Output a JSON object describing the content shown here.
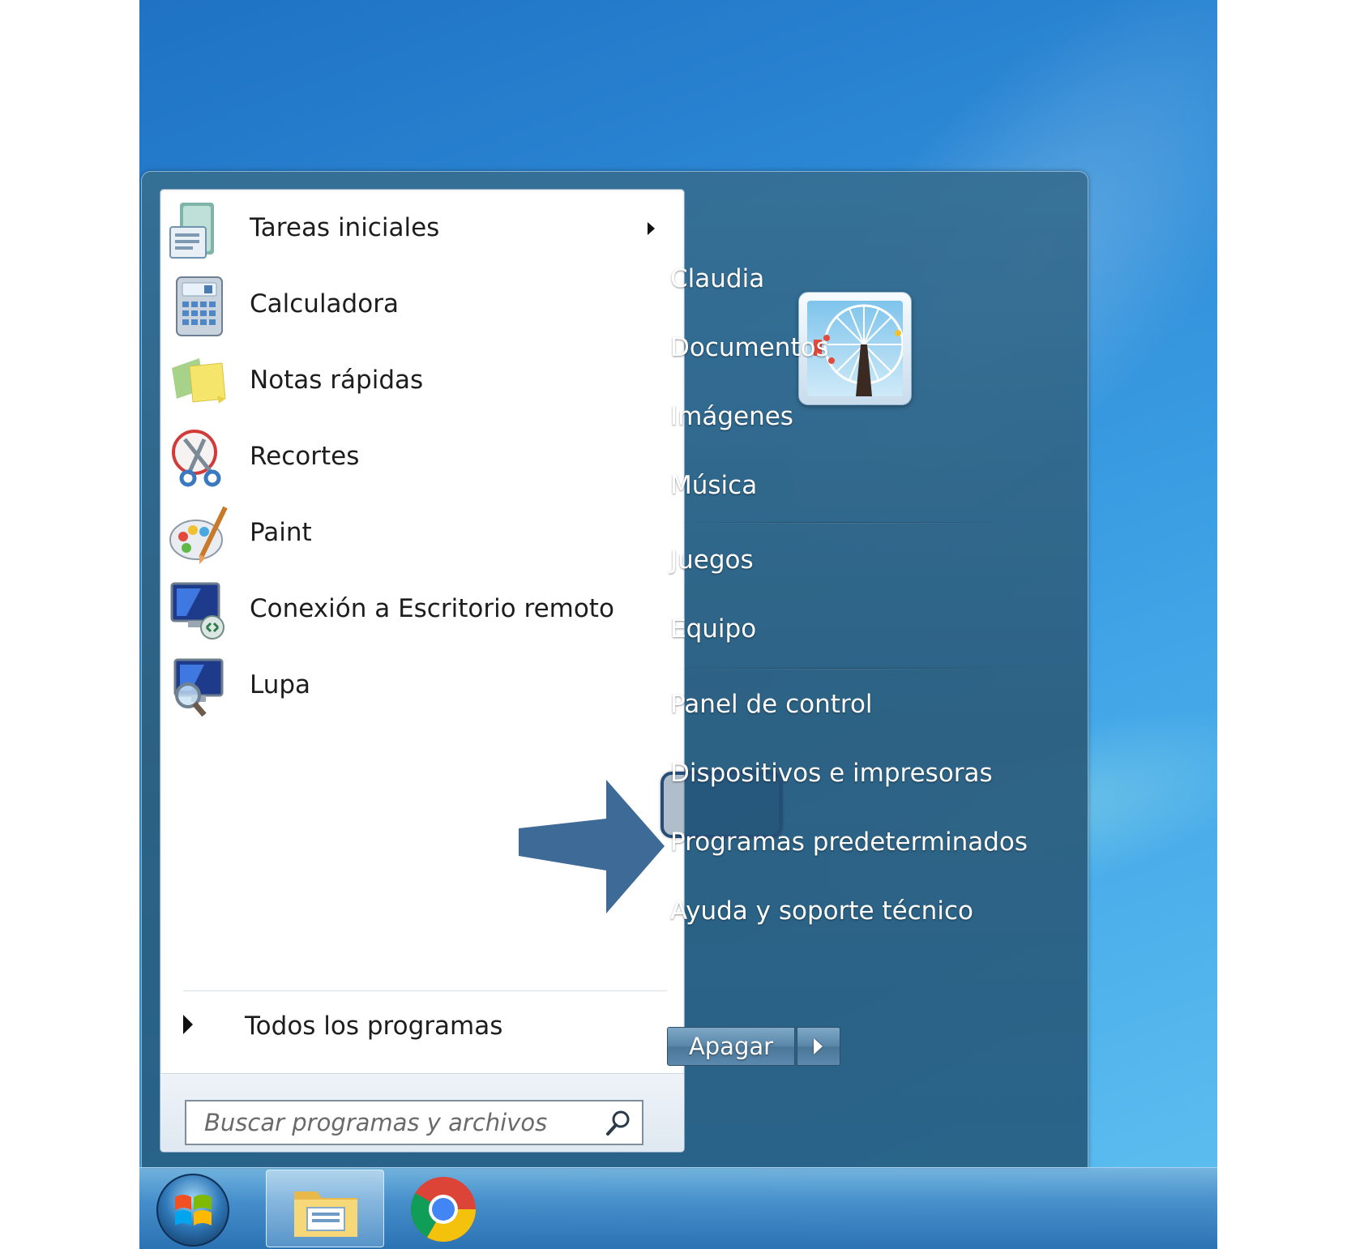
{
  "programs": [
    {
      "label": "Tareas iniciales",
      "icon": "getting-started-icon",
      "has_submenu": true
    },
    {
      "label": "Calculadora",
      "icon": "calculator-icon"
    },
    {
      "label": "Notas rápidas",
      "icon": "sticky-notes-icon"
    },
    {
      "label": "Recortes",
      "icon": "snipping-tool-icon"
    },
    {
      "label": "Paint",
      "icon": "paint-icon"
    },
    {
      "label": "Conexión a Escritorio remoto",
      "icon": "remote-desktop-icon"
    },
    {
      "label": "Lupa",
      "icon": "magnifier-icon"
    }
  ],
  "all_programs": {
    "label": "Todos los programas"
  },
  "search": {
    "placeholder": "Buscar programas y archivos",
    "icon": "search-icon"
  },
  "user": {
    "picture": "ferris-wheel-user-picture"
  },
  "right_links": [
    {
      "label": "Claudia"
    },
    {
      "label": "Documentos"
    },
    {
      "label": "Imágenes"
    },
    {
      "label": "Música"
    },
    {
      "label": "Juegos"
    },
    {
      "label": "Equipo",
      "highlighted": true
    },
    {
      "label": "Panel de control"
    },
    {
      "label": "Dispositivos e impresoras"
    },
    {
      "label": "Programas predeterminados"
    },
    {
      "label": "Ayuda y soporte técnico"
    }
  ],
  "shutdown": {
    "label": "Apagar"
  },
  "taskbar": {
    "items": [
      "start-orb",
      "windows-explorer-icon",
      "chrome-icon"
    ]
  },
  "colors": {
    "highlight_border": "#264c78",
    "callout_arrow": "#3d6a97",
    "menu_glass": "#2f607f"
  }
}
